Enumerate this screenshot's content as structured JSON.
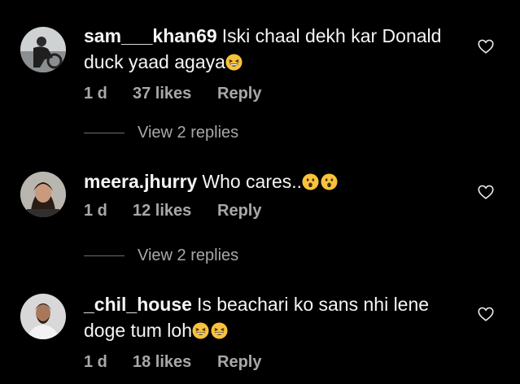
{
  "comments": [
    {
      "username": "sam___khan69",
      "text": "Iski chaal dekh kar Donald duck yaad agaya",
      "emojis": [
        "grinning-squint-face"
      ],
      "time": "1 d",
      "likes": "37 likes",
      "reply_label": "Reply",
      "view_replies": "View 2 replies"
    },
    {
      "username": "meera.jhurry",
      "text": "Who cares..",
      "emojis": [
        "hushed-face",
        "hushed-face"
      ],
      "time": "1 d",
      "likes": "12 likes",
      "reply_label": "Reply",
      "view_replies": "View 2 replies"
    },
    {
      "username": "_chil_house",
      "text": "Is beachari ko sans nhi lene doge tum loh",
      "emojis": [
        "grinning-squint-face",
        "grinning-squint-face"
      ],
      "time": "1 d",
      "likes": "18 likes",
      "reply_label": "Reply"
    }
  ],
  "colors": {
    "background": "#000000",
    "primary_text": "#f5f5f5",
    "secondary_text": "#a8a8a8",
    "emoji_yellow": "#f9c23c"
  },
  "icons": [
    "like-heart-icon",
    "avatar"
  ]
}
